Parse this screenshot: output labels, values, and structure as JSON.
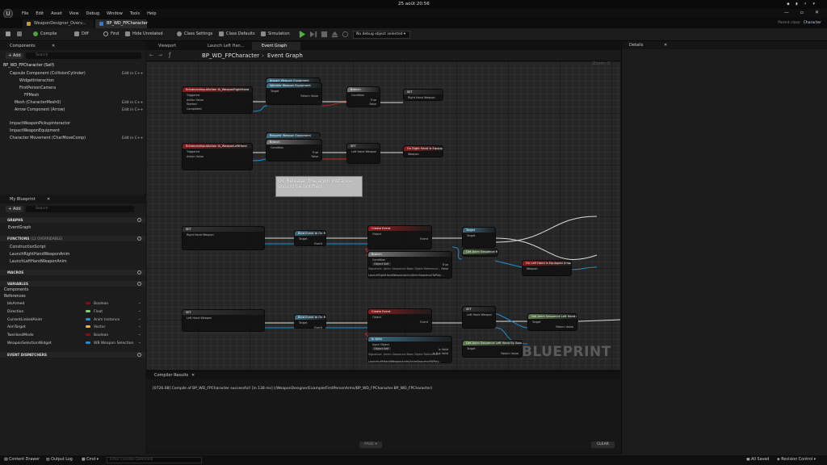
{
  "topbar": {
    "clock": "25 août 20:56",
    "tray": "▪ ◗ ⚡ ▾"
  },
  "menu": {
    "logo": "U",
    "items": [
      "File",
      "Edit",
      "Asset",
      "View",
      "Debug",
      "Window",
      "Tools",
      "Help"
    ]
  },
  "window_controls": {
    "min": "—",
    "max": "▫",
    "close": "✕"
  },
  "tabs": [
    {
      "label": "WeaponDesigner_Overv...",
      "color": "#c9972c",
      "active": false
    },
    {
      "label": "BP_WD_FPCharacter",
      "color": "#2f7ad8",
      "active": true
    }
  ],
  "parent_class": {
    "label": "Parent class:",
    "value": "Character"
  },
  "toolbar": {
    "compile": "Compile",
    "diff": "Diff",
    "find": "Find",
    "hide_unrelated": "Hide Unrelated",
    "class_settings": "Class Settings",
    "class_defaults": "Class Defaults",
    "simulation": "Simulation",
    "debug_object": "No debug object selected"
  },
  "components": {
    "title": "Components",
    "add": "+ Add",
    "search_placeholder": "Search",
    "root": "BP_WD_FPCharacter (Self)",
    "items": [
      {
        "label": "Capsule Component (CollisionCylinder)",
        "edit": "Edit in C++"
      },
      {
        "label": "WidgetInteraction",
        "edit": ""
      },
      {
        "label": "FirstPersonCamera",
        "edit": ""
      },
      {
        "label": "FPMesh",
        "edit": ""
      },
      {
        "label": "Mesh (CharacterMesh0)",
        "edit": "Edit in C++"
      },
      {
        "label": "Arrow Component (Arrow)",
        "edit": "Edit in C++"
      },
      {
        "label": "ImpactWeaponPickupInteractor",
        "edit": ""
      },
      {
        "label": "ImpactWeaponEquipment",
        "edit": ""
      },
      {
        "label": "Character Movement (CharMoveComp)",
        "edit": "Edit in C++"
      }
    ]
  },
  "my_blueprint": {
    "title": "My Blueprint",
    "add": "+ Add",
    "search_placeholder": "Search",
    "graphs_header": "GRAPHS",
    "graphs": [
      "EventGraph"
    ],
    "functions_header": "FUNCTIONS",
    "functions_sub": "(12 OVERRIDABLE)",
    "functions": [
      "ConstructionScript",
      "LaunchRightHandWeaponAnim",
      "LaunchLeftHandWeaponAnim"
    ],
    "macros_header": "MACROS",
    "variables_header": "VARIABLES",
    "var_groups": [
      "Components",
      "References"
    ],
    "variables": [
      {
        "name": "bIsArmed",
        "type": "Boolean",
        "color": "#8c0c0c"
      },
      {
        "name": "Direction",
        "type": "Float",
        "color": "#7cd36b"
      },
      {
        "name": "CurrentLinkedAnim",
        "type": "Anim Instance",
        "color": "#1e8fd8"
      },
      {
        "name": "AimTarget",
        "type": "Vector",
        "color": "#e7c02a"
      },
      {
        "name": "TwoHandMode",
        "type": "Boolean",
        "color": "#8c0c0c"
      },
      {
        "name": "WeaponSelectionWidget",
        "type": "WB Weapon Selection",
        "color": "#1e8fd8"
      }
    ],
    "dispatchers_header": "EVENT DISPATCHERS"
  },
  "graph_tabs": [
    {
      "label": "Viewport",
      "active": false
    },
    {
      "label": "Launch Left Han...",
      "active": false
    },
    {
      "label": "Event Graph",
      "active": true
    }
  ],
  "breadcrumb": {
    "root": "BP_WD_FPCharacter",
    "sep": "›",
    "leaf": "Event Graph",
    "zoom": "Zoom -3"
  },
  "graph": {
    "comment": "On Release: the anim instance should be notified",
    "watermark": "BLUEPRINT",
    "nodes": [
      {
        "title": "EnhancedInputAction IA_WeaponRightHand",
        "color": "#8b1b1b",
        "pins": [
          "Triggered",
          "Action Value",
          "Started",
          "Completed"
        ]
      },
      {
        "title": "Impact Weapon Equipment",
        "color": "#3a6d84",
        "pins": []
      },
      {
        "title": "Validate Weapon Equipment",
        "color": "#3a6d84",
        "pins": [
          "Target",
          "Return Value"
        ]
      },
      {
        "title": "Branch",
        "color": "#777777",
        "pins": [
          "Condition",
          "True",
          "False"
        ]
      },
      {
        "title": "SET",
        "color": "#333333",
        "pins": [
          "Right Hand Weapon"
        ]
      },
      {
        "title": "EnhancedInputAction IA_WeaponLeftHand",
        "color": "#8b1b1b",
        "pins": [
          "Triggered",
          "Action Value"
        ]
      },
      {
        "title": "Request Weapon Equipment",
        "color": "#3a6d84",
        "pins": [
          "Target",
          "Return Value"
        ]
      },
      {
        "title": "Branch",
        "color": "#777777",
        "pins": [
          "Condition",
          "True",
          "False"
        ]
      },
      {
        "title": "SET",
        "color": "#333333",
        "pins": [
          "Left Hand Weapon"
        ]
      },
      {
        "title": "On Right Hand Is Equipped (ImpactWeaponEquipment)",
        "color": "#8b1b1b",
        "pins": [
          "Weapon"
        ]
      },
      {
        "title": "SET",
        "color": "#333333",
        "pins": [
          "Right Hand Weapon"
        ]
      },
      {
        "title": "Bind Event to On Request To Play Anim",
        "color": "#3a6d84",
        "pins": [
          "Target",
          "Event"
        ]
      },
      {
        "title": "Create Event",
        "color": "#8b1b1b",
        "pins": [
          "Object",
          "Event"
        ]
      },
      {
        "title": "Branch",
        "color": "#777777",
        "pins": [
          "Condition",
          "True",
          "False"
        ]
      },
      {
        "title": "Target",
        "color": "#3a6d84",
        "pins": [
          "Target"
        ]
      },
      {
        "title": "Get Anim Sequence Right Hand By Asset",
        "color": "#5b7a4a",
        "pins": [
          "Target",
          "Return Value"
        ]
      },
      {
        "title": "On Left Hand Is Equipped (ImpactWeaponEquipment)",
        "color": "#8b1b1b",
        "pins": [
          "Weapon"
        ]
      },
      {
        "title": "SET",
        "color": "#333333",
        "pins": [
          "Left Hand Weapon"
        ]
      },
      {
        "title": "Bind Event to On Request To Play Anim",
        "color": "#3a6d84",
        "pins": [
          "Target",
          "Event"
        ]
      },
      {
        "title": "Create Event",
        "color": "#8b1b1b",
        "pins": [
          "Object",
          "Event"
        ]
      },
      {
        "title": "Is Valid",
        "color": "#3a6d84",
        "pins": [
          "Input Object",
          "Is Valid",
          "Is Not Valid"
        ]
      },
      {
        "title": "SET",
        "color": "#333333",
        "pins": [
          "Left Hand Weapon"
        ]
      },
      {
        "title": "Get Anim Sequence Left Hand By Asset",
        "color": "#5b7a4a",
        "pins": [
          "Target",
          "Return Value"
        ]
      }
    ],
    "create_event_right_fn": "LaunchRightHandWeaponAnim(AnimSequenceToPlay...",
    "create_event_left_fn": "LaunchLeftHandWeaponAnim(AnimSequenceToPlay...",
    "signature": "Signature: (Anim Sequence Base Object Reference...",
    "self_label": "Object Self"
  },
  "details": {
    "title": "Details"
  },
  "compiler": {
    "title": "Compiler Results",
    "log": "[0726.08] Compile of BP_WD_FPCharacter successful! [in 138 ms] (/WeaponDesigner/Example/FirstPersonArms/BP_WD_FPCharacter.BP_WD_FPCharacter)",
    "page": "PAGE ▾",
    "clear": "CLEAR"
  },
  "bottombar": {
    "content_drawer": "Content Drawer",
    "output_log": "Output Log",
    "cmd": "Cmd ▾",
    "console_placeholder": "Enter Console Command",
    "all_saved": "All Saved",
    "revision": "Revision Control ▾"
  }
}
